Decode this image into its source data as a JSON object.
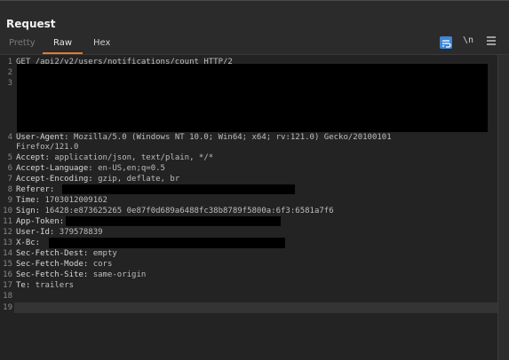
{
  "panel": {
    "title": "Request",
    "tabs": [
      {
        "label": "Pretty",
        "active": false
      },
      {
        "label": "Raw",
        "active": true
      },
      {
        "label": "Hex",
        "active": false
      }
    ],
    "toolbar": {
      "wrap_icon": "wrap-lines-icon",
      "newline_label": "\\n",
      "menu_icon": "hamburger-menu-icon"
    }
  },
  "colors": {
    "accent": "#e8772e",
    "toggle_active": "#3f86d6",
    "background": "#2b2b2b",
    "editor_bg": "#232323"
  },
  "request_lines": [
    {
      "num": "1",
      "name": "",
      "value": "GET /api2/v2/users/notifications/count HTTP/2"
    },
    {
      "num": "2",
      "name": "",
      "value": ""
    },
    {
      "num": "3",
      "name": "",
      "value": ""
    },
    {
      "num": "4",
      "name": "User-Agent:",
      "value": " Mozilla/5.0 (Windows NT 10.0; Win64; x64; rv:121.0) Gecko/20100101"
    },
    {
      "num": "",
      "name": "",
      "value": "Firefox/121.0"
    },
    {
      "num": "5",
      "name": "Accept:",
      "value": " application/json, text/plain, */*"
    },
    {
      "num": "6",
      "name": "Accept-Language:",
      "value": " en-US,en;q=0.5"
    },
    {
      "num": "7",
      "name": "Accept-Encoding:",
      "value": " gzip, deflate, br"
    },
    {
      "num": "8",
      "name": "Referer:",
      "value": ""
    },
    {
      "num": "9",
      "name": "Time:",
      "value": " 1703012009162"
    },
    {
      "num": "10",
      "name": "Sign:",
      "value": " 16428:e873625265 0e87f0d689a6488fc38b8789f5800a:6f3:6581a7f6"
    },
    {
      "num": "11",
      "name": "App-Token:",
      "value": ""
    },
    {
      "num": "12",
      "name": "User-Id:",
      "value": " 379578839"
    },
    {
      "num": "13",
      "name": "X-Bc:",
      "value": ""
    },
    {
      "num": "14",
      "name": "Sec-Fetch-Dest:",
      "value": " empty"
    },
    {
      "num": "15",
      "name": "Sec-Fetch-Mode:",
      "value": " cors"
    },
    {
      "num": "16",
      "name": "Sec-Fetch-Site:",
      "value": " same-origin"
    },
    {
      "num": "17",
      "name": "Te:",
      "value": " trailers"
    },
    {
      "num": "18",
      "name": "",
      "value": ""
    },
    {
      "num": "19",
      "name": "",
      "value": ""
    }
  ]
}
